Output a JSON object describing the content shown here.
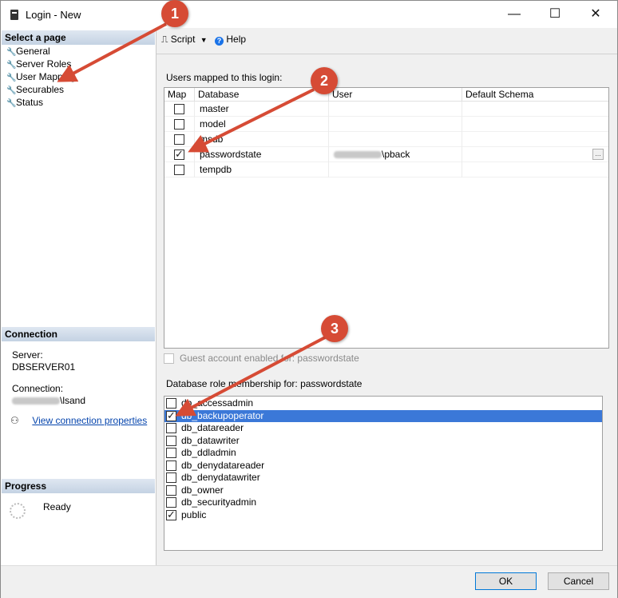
{
  "window": {
    "title": "Login - New",
    "minimize": "—",
    "maximize": "☐",
    "close": "✕"
  },
  "sidebar": {
    "select_page_header": "Select a page",
    "items": [
      {
        "label": "General"
      },
      {
        "label": "Server Roles"
      },
      {
        "label": "User Mapping"
      },
      {
        "label": "Securables"
      },
      {
        "label": "Status"
      }
    ],
    "connection_header": "Connection",
    "server_label": "Server:",
    "server_value": "DBSERVER01",
    "connection_label": "Connection:",
    "connection_value": "\\lsand",
    "view_props_link": "View connection properties",
    "progress_header": "Progress",
    "progress_status": "Ready"
  },
  "toolbar": {
    "script_label": "Script",
    "help_label": "Help"
  },
  "users_grid": {
    "label": "Users mapped to this login:",
    "columns": [
      "Map",
      "Database",
      "User",
      "Default Schema"
    ],
    "rows": [
      {
        "map": false,
        "database": "master",
        "user": "",
        "schema": ""
      },
      {
        "map": false,
        "database": "model",
        "user": "",
        "schema": ""
      },
      {
        "map": false,
        "database": "msdb",
        "user": "",
        "schema": ""
      },
      {
        "map": true,
        "database": "passwordstate",
        "user": "\\pback",
        "schema": ""
      },
      {
        "map": false,
        "database": "tempdb",
        "user": "",
        "schema": ""
      }
    ],
    "ellipsis": "..."
  },
  "guest_account": {
    "label": "Guest account enabled for: passwordstate",
    "checked": false
  },
  "roles": {
    "label": "Database role membership for: passwordstate",
    "items": [
      {
        "name": "db_accessadmin",
        "checked": false,
        "selected": false
      },
      {
        "name": "db_backupoperator",
        "checked": true,
        "selected": true
      },
      {
        "name": "db_datareader",
        "checked": false,
        "selected": false
      },
      {
        "name": "db_datawriter",
        "checked": false,
        "selected": false
      },
      {
        "name": "db_ddladmin",
        "checked": false,
        "selected": false
      },
      {
        "name": "db_denydatareader",
        "checked": false,
        "selected": false
      },
      {
        "name": "db_denydatawriter",
        "checked": false,
        "selected": false
      },
      {
        "name": "db_owner",
        "checked": false,
        "selected": false
      },
      {
        "name": "db_securityadmin",
        "checked": false,
        "selected": false
      },
      {
        "name": "public",
        "checked": true,
        "selected": false
      }
    ]
  },
  "buttons": {
    "ok": "OK",
    "cancel": "Cancel"
  },
  "annotations": {
    "color": "#d64b35",
    "markers": [
      "1",
      "2",
      "3"
    ]
  }
}
